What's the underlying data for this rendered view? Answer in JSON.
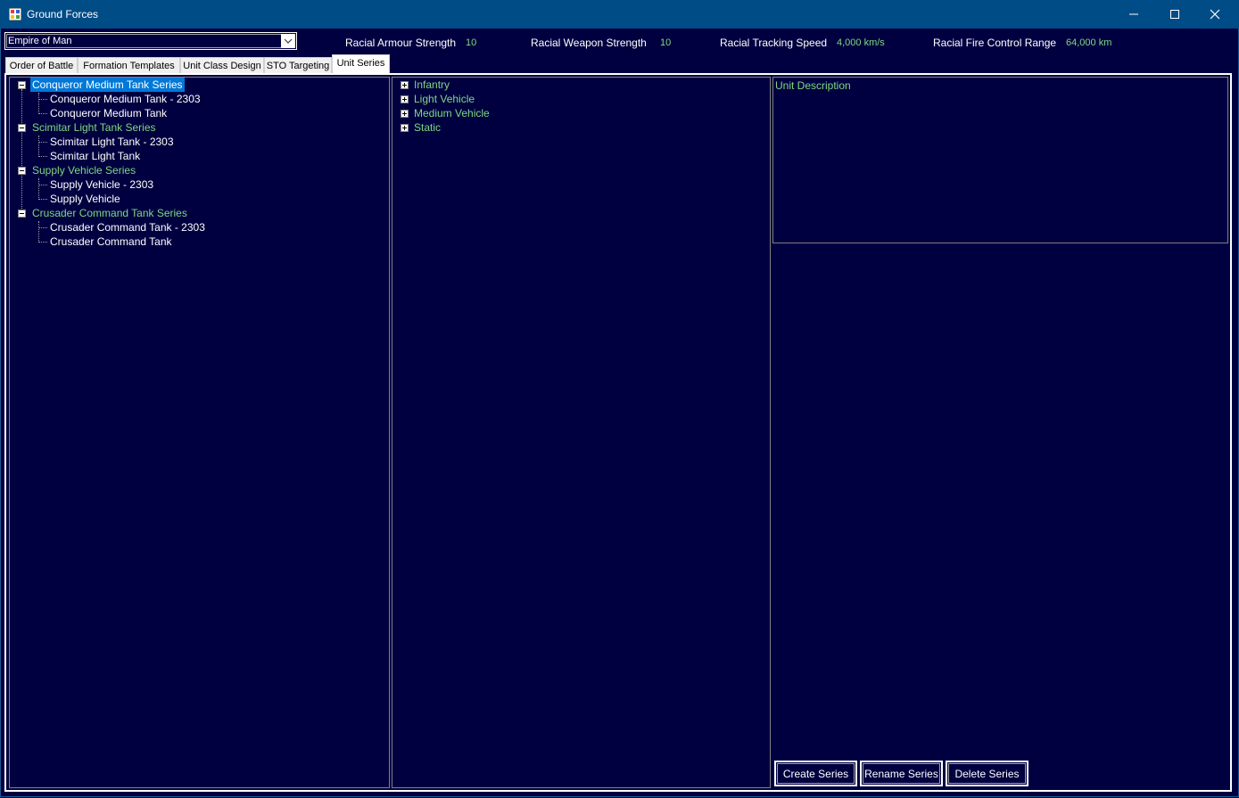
{
  "window": {
    "title": "Ground Forces",
    "icon": "app-grid-icon",
    "controls": [
      "minimize-icon",
      "maximize-icon",
      "close-icon"
    ]
  },
  "race_selector": {
    "value": "Empire of Man"
  },
  "stats": [
    {
      "label": "Racial Armour Strength",
      "value": "10"
    },
    {
      "label": "Racial Weapon Strength",
      "value": "10"
    },
    {
      "label": "Racial Tracking Speed",
      "value": "4,000 km/s"
    },
    {
      "label": "Racial Fire Control Range",
      "value": "64,000 km"
    }
  ],
  "tabs": [
    {
      "label": "Order of Battle",
      "active": false
    },
    {
      "label": "Formation Templates",
      "active": false
    },
    {
      "label": "Unit Class Design",
      "active": false
    },
    {
      "label": "STO Targeting",
      "active": false
    },
    {
      "label": "Unit Series",
      "active": true
    }
  ],
  "series_tree": [
    {
      "label": "Conqueror Medium Tank Series",
      "selected": true,
      "children": [
        "Conqueror Medium Tank - 2303",
        "Conqueror Medium Tank"
      ]
    },
    {
      "label": "Scimitar Light Tank Series",
      "selected": false,
      "children": [
        "Scimitar Light Tank - 2303",
        "Scimitar Light Tank"
      ]
    },
    {
      "label": "Supply Vehicle Series",
      "selected": false,
      "children": [
        "Supply Vehicle - 2303",
        "Supply Vehicle"
      ]
    },
    {
      "label": "Crusader Command Tank Series",
      "selected": false,
      "children": [
        "Crusader Command Tank - 2303",
        "Crusader Command Tank"
      ]
    }
  ],
  "class_tree": [
    {
      "label": "Infantry"
    },
    {
      "label": "Light Vehicle"
    },
    {
      "label": "Medium Vehicle"
    },
    {
      "label": "Static"
    }
  ],
  "description": {
    "label": "Unit Description"
  },
  "buttons": {
    "create": "Create Series",
    "rename": "Rename Series",
    "delete": "Delete Series"
  },
  "colors": {
    "background": "#000040",
    "titlebar": "#004c86",
    "accent_text": "#7fd87f",
    "selection": "#0078d7"
  }
}
